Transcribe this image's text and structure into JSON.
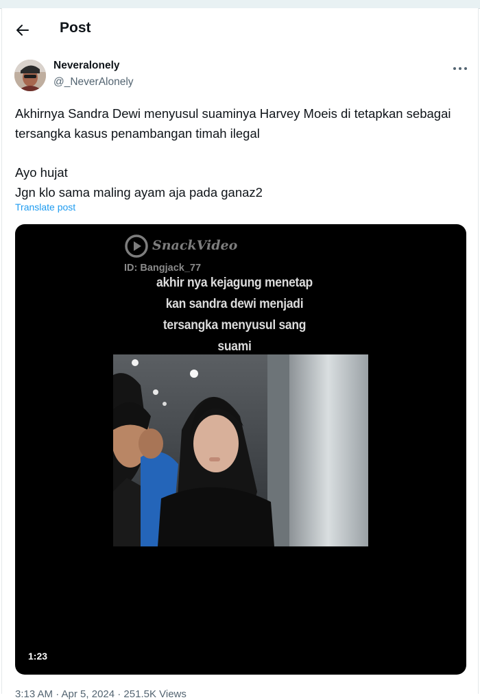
{
  "header": {
    "title": "Post",
    "back_icon": "arrow-left-icon"
  },
  "author": {
    "display_name": "Neveralonely",
    "handle": "@_NeverAlonely",
    "more_icon": "ellipsis-horizontal-icon"
  },
  "post": {
    "lines": [
      "Akhirnya Sandra Dewi menyusul suaminya Harvey Moeis di tetapkan sebagai tersangka kasus penambangan timah ilegal",
      "Ayo hujat",
      "Jgn klo sama maling ayam aja pada ganaz2"
    ],
    "translate_label": "Translate post"
  },
  "media": {
    "watermark_brand": "SnackVideo",
    "watermark_id": "ID: Bangjack_77",
    "caption_lines": [
      "akhir nya kejagung menetap",
      "kan sandra dewi menjadi",
      "tersangka menyusul sang",
      "suami"
    ],
    "duration": "1:23"
  },
  "footer": {
    "timestamp": "3:13 AM · Apr 5, 2024 · 251.5K Views"
  },
  "colors": {
    "text_primary": "#0f1419",
    "text_secondary": "#536471",
    "link": "#1d9bf0",
    "media_bg": "#000000"
  }
}
